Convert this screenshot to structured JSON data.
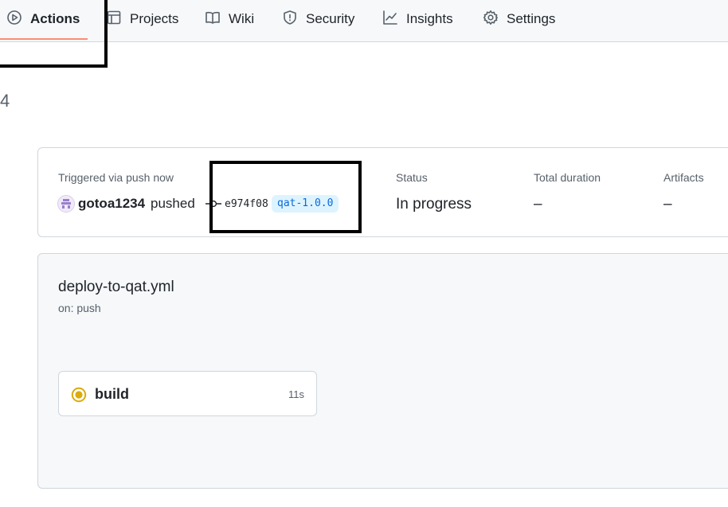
{
  "nav": {
    "tabs": [
      {
        "label": "Actions",
        "icon": "play-icon",
        "selected": true
      },
      {
        "label": "Projects",
        "icon": "table-icon",
        "selected": false
      },
      {
        "label": "Wiki",
        "icon": "book-icon",
        "selected": false
      },
      {
        "label": "Security",
        "icon": "shield-icon",
        "selected": false
      },
      {
        "label": "Insights",
        "icon": "graph-icon",
        "selected": false
      },
      {
        "label": "Settings",
        "icon": "gear-icon",
        "selected": false
      }
    ]
  },
  "run": {
    "number_fragment": "4"
  },
  "summary": {
    "triggered_label": "Triggered via push now",
    "user": "gotoa1234",
    "action": "pushed",
    "commit_sha": "e974f08",
    "tag": "qat-1.0.0",
    "status_label": "Status",
    "status_value": "In progress",
    "duration_label": "Total duration",
    "duration_value": "–",
    "artifacts_label": "Artifacts",
    "artifacts_value": "–"
  },
  "workflow": {
    "file": "deploy-to-qat.yml",
    "trigger": "on: push",
    "jobs": [
      {
        "name": "build",
        "duration": "11s",
        "status": "in-progress"
      }
    ]
  },
  "colors": {
    "accent_underline": "#fd8c73",
    "in_progress": "#dbab0a",
    "tag_bg": "#ddf4ff",
    "tag_fg": "#0969da"
  }
}
